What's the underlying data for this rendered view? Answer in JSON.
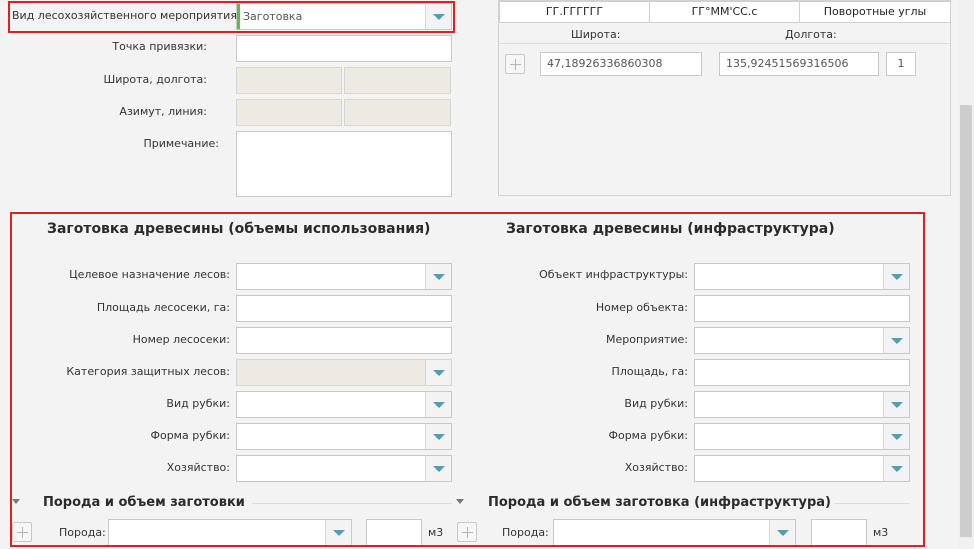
{
  "top_form": {
    "activity_label": "Вид лесохозяйственного мероприятия:",
    "activity_value": "Заготовка",
    "anchor_point_label": "Точка привязки:",
    "anchor_point_value": "",
    "latlon_label": "Широта, долгота:",
    "azimuth_label": "Азимут, линия:",
    "note_label": "Примечание:"
  },
  "coords": {
    "tabs": [
      {
        "label": "ГГ.ГГГГГГ"
      },
      {
        "label": "ГГ°ММ'СС.с"
      },
      {
        "label": "Поворотные углы"
      }
    ],
    "lat_header": "Широта:",
    "lon_header": "Долгота:",
    "row": {
      "lat": "47,18926336860308",
      "lon": "135,92451569316506",
      "num": "1"
    }
  },
  "harvest_usage": {
    "title": "Заготовка древесины (объемы использования)",
    "fields": [
      {
        "label": "Целевое назначение лесов:"
      },
      {
        "label": "Площадь лесосеки, га:"
      },
      {
        "label": "Номер лесосеки:"
      },
      {
        "label": "Категория защитных лесов:"
      },
      {
        "label": "Вид рубки:"
      },
      {
        "label": "Форма рубки:"
      },
      {
        "label": "Хозяйство:"
      }
    ]
  },
  "harvest_infra": {
    "title": "Заготовка древесины (инфраструктура)",
    "fields": [
      {
        "label": "Объект инфраструктуры:"
      },
      {
        "label": "Номер объекта:"
      },
      {
        "label": "Мероприятие:"
      },
      {
        "label": "Площадь, га:"
      },
      {
        "label": "Вид рубки:"
      },
      {
        "label": "Форма рубки:"
      },
      {
        "label": "Хозяйство:"
      }
    ]
  },
  "species_usage": {
    "title": "Порода и объем заготовки",
    "species_label": "Порода:",
    "unit": "м3"
  },
  "species_infra": {
    "title": "Порода и объем заготовка (инфраструктура)",
    "species_label": "Порода:",
    "unit": "м3"
  },
  "colors": {
    "highlight": "#e02020",
    "accent": "#4f9eb8",
    "focus_bar": "#5fbf3f"
  }
}
